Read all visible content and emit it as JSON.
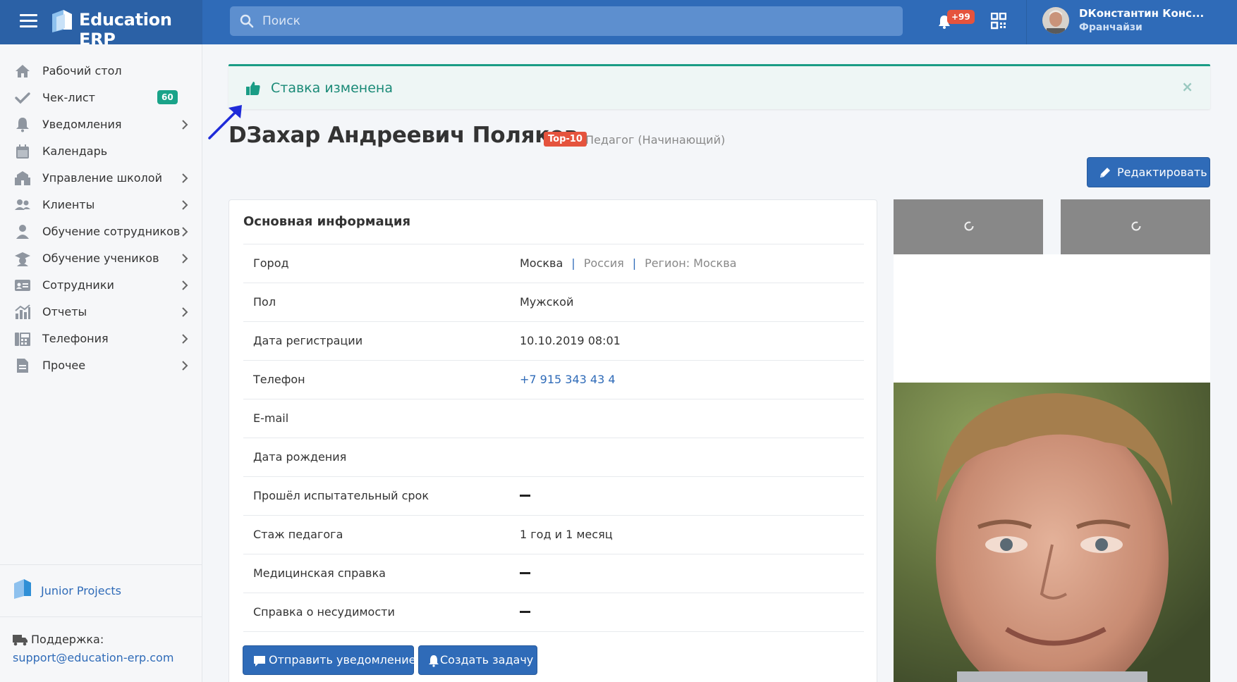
{
  "header": {
    "app_title": "Education ERP",
    "search_placeholder": "Поиск",
    "notifications_badge": "+99",
    "user_name": "DКонстантин Конс...",
    "user_role": "Франчайзи"
  },
  "sidebar": {
    "items": [
      {
        "label": "Рабочий стол",
        "icon": "home-icon",
        "chevron": false
      },
      {
        "label": "Чек-лист",
        "icon": "check-icon",
        "chevron": false,
        "badge": "60"
      },
      {
        "label": "Уведомления",
        "icon": "bell-icon",
        "chevron": true
      },
      {
        "label": "Календарь",
        "icon": "calendar-icon",
        "chevron": false
      },
      {
        "label": "Управление школой",
        "icon": "school-icon",
        "chevron": true
      },
      {
        "label": "Клиенты",
        "icon": "users-icon",
        "chevron": true
      },
      {
        "label": "Обучение сотрудников",
        "icon": "user-icon",
        "chevron": true
      },
      {
        "label": "Обучение учеников",
        "icon": "graduation-cap-icon",
        "chevron": true
      },
      {
        "label": "Сотрудники",
        "icon": "id-card-icon",
        "chevron": true
      },
      {
        "label": "Отчеты",
        "icon": "chart-icon",
        "chevron": true
      },
      {
        "label": "Телефония",
        "icon": "fax-icon",
        "chevron": true
      },
      {
        "label": "Прочее",
        "icon": "file-icon",
        "chevron": true
      }
    ],
    "brand_link": "Junior Projects",
    "support_title": "Поддержка:",
    "support_email": "support@education-erp.com"
  },
  "alert": {
    "text": "Ставка изменена",
    "close": "×"
  },
  "profile": {
    "name": "DЗахар Андреевич Поляков",
    "rank_badge": "Top-10",
    "role": "Педагог (Начинающий)",
    "edit_label": "Редактировать"
  },
  "info_card": {
    "title": "Основная информация",
    "city": {
      "label": "Город",
      "city": "Москва",
      "country": "Россия",
      "region": "Регион: Москва",
      "sep": "|"
    },
    "rows": [
      {
        "label": "Пол",
        "value": "Мужской"
      },
      {
        "label": "Дата регистрации",
        "value": "10.10.2019 08:01"
      },
      {
        "label": "Телефон",
        "value": "+7 915 343 43 4"
      },
      {
        "label": "E-mail",
        "value": ""
      },
      {
        "label": "Дата рождения",
        "value": ""
      },
      {
        "label": "Прошёл испытательный срок",
        "value": ""
      },
      {
        "label": "Стаж педагога",
        "value": "1 год и 1 месяц"
      },
      {
        "label": "Медицинская справка",
        "value": ""
      },
      {
        "label": "Справка о несудимости",
        "value": ""
      }
    ],
    "send_notification_label": "Отправить уведомление",
    "create_task_label": "Создать задачу"
  },
  "colors": {
    "primary": "#2f6bb8",
    "success": "#1a9c85",
    "danger": "#e5533d"
  }
}
